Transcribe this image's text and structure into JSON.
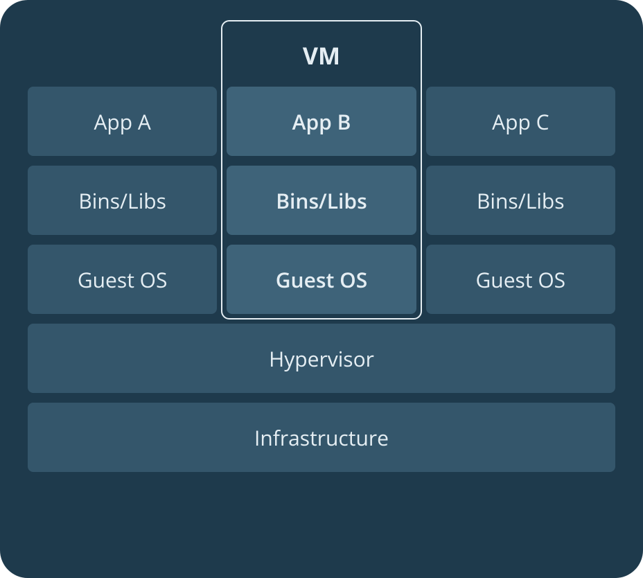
{
  "diagram": {
    "vm_label": "VM",
    "columns": [
      {
        "app": "App A",
        "bins": "Bins/Libs",
        "os": "Guest OS",
        "highlighted": false
      },
      {
        "app": "App B",
        "bins": "Bins/Libs",
        "os": "Guest OS",
        "highlighted": true
      },
      {
        "app": "App C",
        "bins": "Bins/Libs",
        "os": "Guest OS",
        "highlighted": false
      }
    ],
    "hypervisor": "Hypervisor",
    "infrastructure": "Infrastructure"
  }
}
